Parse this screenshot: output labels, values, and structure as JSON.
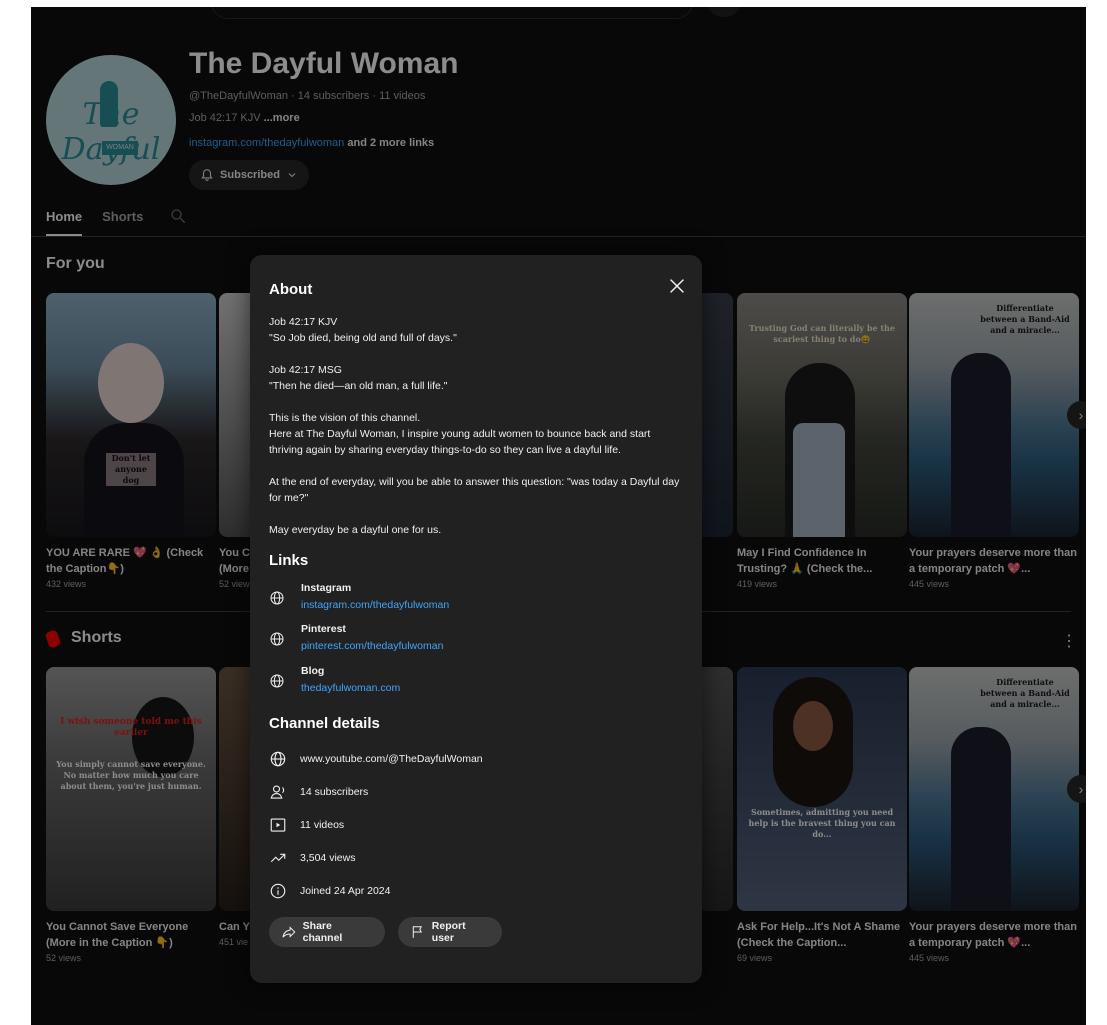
{
  "channel": {
    "name": "The Dayful Woman",
    "handle_line": "@TheDayfulWoman · 14 subscribers · 11 videos",
    "desc_preview": "Job 42:17 KJV",
    "desc_more": "...more",
    "primary_link": "instagram.com/thedayfulwoman",
    "more_links": "and 2 more links",
    "subscribe_label": "Subscribed",
    "avatar_text": "The Dayful",
    "avatar_sub": "WOMAN"
  },
  "tabs": [
    {
      "label": "Home"
    },
    {
      "label": "Shorts"
    }
  ],
  "sections": {
    "for_you": "For you",
    "shorts": "Shorts"
  },
  "for_you_videos": [
    {
      "title": "YOU ARE RARE 💖 👌 (Check the Caption👇)",
      "views": "432 views",
      "overlay": "Don't let anyone dog"
    },
    {
      "title": "You Ca (More",
      "views": "52 view"
    },
    {
      "title": "May I Find Confidence In Trusting? 🙏 (Check the...",
      "views": "419 views",
      "overlay": "Trusting God can literally be the scariest thing to do😄"
    },
    {
      "title": "Your prayers deserve more than a temporary patch 💖...",
      "views": "445 views",
      "overlay": "Differentiate between a Band-Aid and a miracle..."
    }
  ],
  "shorts_videos": [
    {
      "title": "You Cannot Save Everyone (More in the Caption 👇)",
      "views": "52 views",
      "overlay_red": "I wish someone told me this earlier",
      "overlay_white": "You simply cannot save everyone. No matter how much you care about them, you're just human."
    },
    {
      "title": "Can Y",
      "views": "451 vie"
    },
    {
      "title": "Ask For Help...It's Not A Shame (Check the Caption...",
      "views": "69 views",
      "overlay": "Sometimes, admitting you need help is the bravest thing you can do..."
    },
    {
      "title": "Your prayers deserve more than a temporary patch 💖...",
      "views": "445 views",
      "overlay": "Differentiate between a Band-Aid and a miracle..."
    }
  ],
  "about": {
    "title": "About",
    "description": [
      "Job 42:17 KJV\n\"So Job died, being old and full of days.\"",
      "Job 42:17 MSG\n\"Then he died—an old man, a full life.\"",
      "This is the vision of this channel.\nHere at The Dayful Woman, I inspire young adult women to bounce back and start thriving again by sharing everyday things-to-do so they can live a dayful life.",
      "At the end of everyday, will you be able to answer this question: \"was today a Dayful day for me?\"",
      "May everyday be a dayful one for us."
    ],
    "links_heading": "Links",
    "links": [
      {
        "name": "Instagram",
        "url": "instagram.com/thedayfulwoman"
      },
      {
        "name": "Pinterest",
        "url": "pinterest.com/thedayfulwoman"
      },
      {
        "name": "Blog",
        "url": "thedayfulwoman.com"
      }
    ],
    "details_heading": "Channel details",
    "details": {
      "url": "www.youtube.com/@TheDayfulWoman",
      "subscribers": "14 subscribers",
      "videos": "11 videos",
      "views": "3,504 views",
      "joined": "Joined 24 Apr 2024"
    },
    "share_label": "Share channel",
    "report_label": "Report user"
  },
  "colors": {
    "background": "#0f0f0f",
    "dialog": "#212121",
    "link": "#3ea6ff",
    "shorts_red": "#ff0000"
  }
}
